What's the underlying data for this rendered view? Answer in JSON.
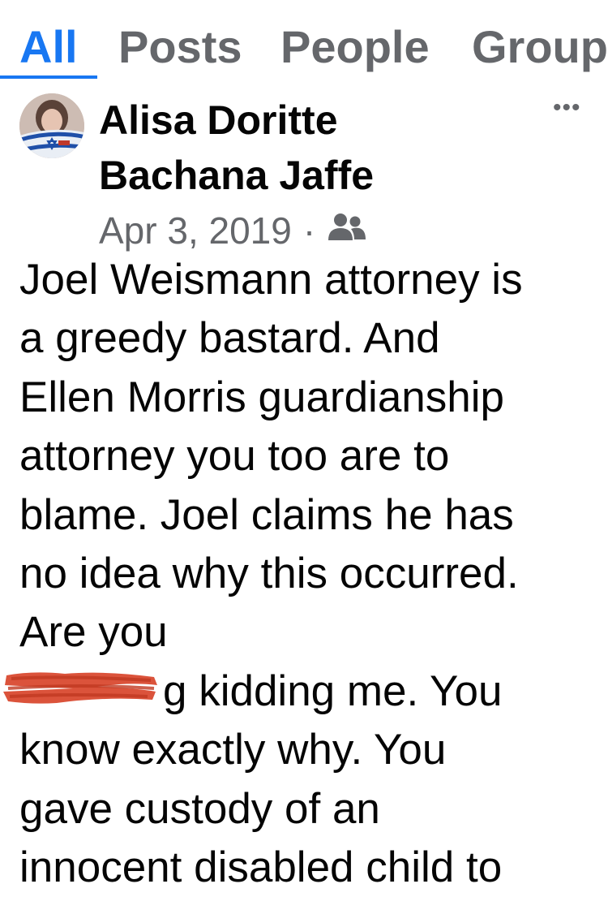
{
  "tabs": [
    {
      "label": "All",
      "active": true
    },
    {
      "label": "Posts",
      "active": false
    },
    {
      "label": "People",
      "active": false
    },
    {
      "label": "Group",
      "active": false
    }
  ],
  "post": {
    "author_line1": "Alisa Doritte",
    "author_line2": "Bachana Jaffe",
    "date": "Apr 3, 2019",
    "separator": "·",
    "privacy_icon": "friends-icon",
    "more_icon": "more-options-icon",
    "body_lines": [
      "Joel Weismann attorney is",
      "a greedy bastard.   And",
      "Ellen Morris guardianship",
      "attorney you too are to",
      "blame.   Joel claims he has",
      "no idea why this occurred.",
      "Are you",
      "F⁣ucking kidding me.   You",
      "know exactly why.   You",
      "gave custody of an",
      "innocent disabled child to"
    ],
    "redacted_line_visible": "g kidding me.   You"
  },
  "colors": {
    "accent": "#1877f2",
    "muted": "#65676b",
    "text": "#050505",
    "redaction": "#d8442a"
  }
}
